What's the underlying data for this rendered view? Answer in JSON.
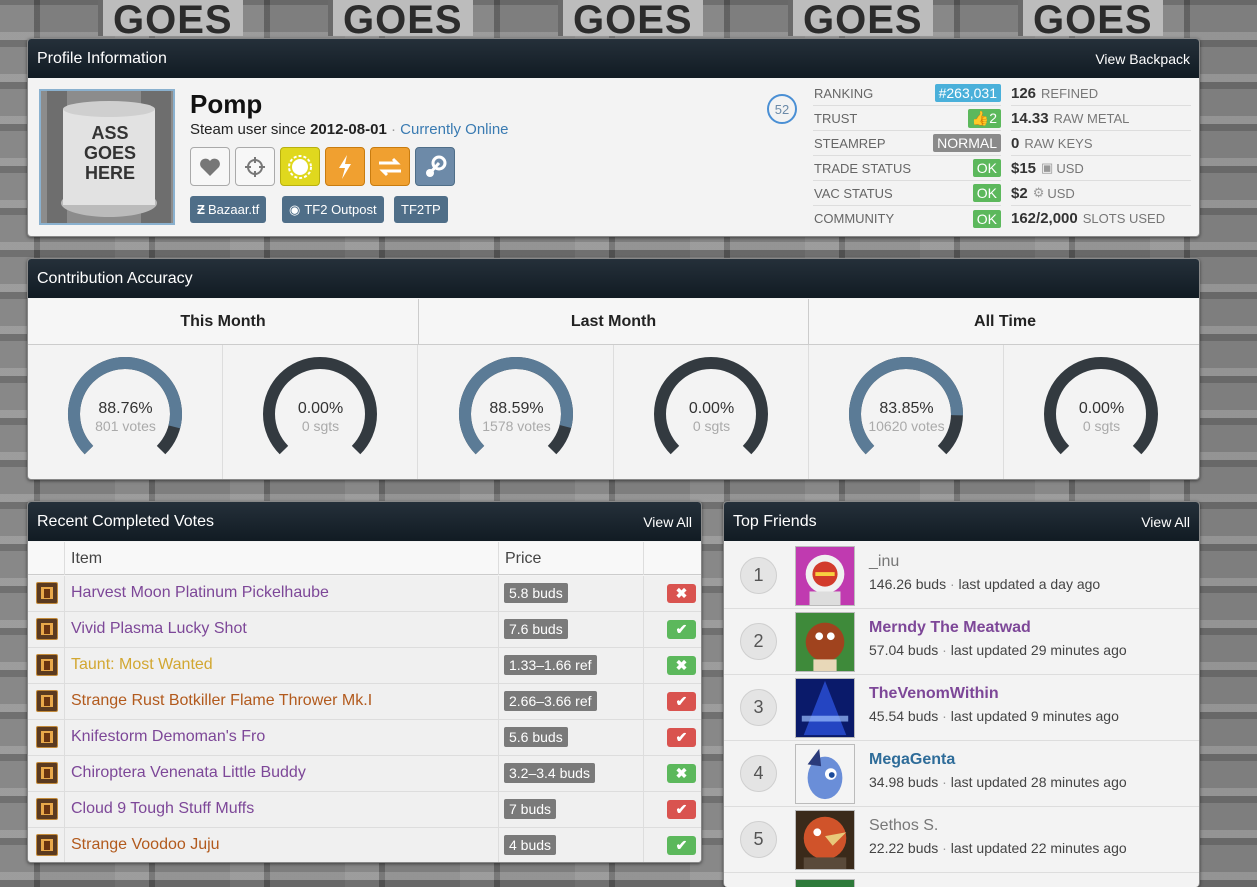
{
  "background": {
    "word": "GOES"
  },
  "profile": {
    "header": "Profile Information",
    "view_backpack": "View Backpack",
    "avatar_text": "ASS GOES HERE",
    "name": "Pomp",
    "since_prefix": "Steam user since ",
    "since_date": "2012-08-01",
    "separator": " · ",
    "status": "Currently Online",
    "level": "52",
    "icons": [
      {
        "name": "heart-icon",
        "color": "#f4f4f4"
      },
      {
        "name": "crosshair-icon",
        "color": "#f4f4f4"
      },
      {
        "name": "sun-icon",
        "color": "#e0d81e"
      },
      {
        "name": "lightning-icon",
        "color": "#f0a030"
      },
      {
        "name": "exchange-icon",
        "color": "#f0a030"
      },
      {
        "name": "steam-icon",
        "color": "#6d8aa8"
      }
    ],
    "links": [
      {
        "label": "Bazaar.tf",
        "icon": "bazaar-icon"
      },
      {
        "label": "TF2 Outpost",
        "icon": "outpost-icon"
      },
      {
        "label": "TF2TP",
        "icon": ""
      }
    ],
    "stats": [
      {
        "label": "RANKING",
        "value": "#263,031",
        "color": "#4ab0da"
      },
      {
        "label": "TRUST",
        "value": "2",
        "color": "#5cb85c",
        "icon": "thumbs-up-icon"
      },
      {
        "label": "STEAMREP",
        "value": "NORMAL",
        "color": "#8a8a8a"
      },
      {
        "label": "TRADE STATUS",
        "value": "OK",
        "color": "#5cb85c"
      },
      {
        "label": "VAC STATUS",
        "value": "OK",
        "color": "#5cb85c"
      },
      {
        "label": "COMMUNITY",
        "value": "OK",
        "color": "#5cb85c"
      }
    ],
    "resources": [
      {
        "value": "126",
        "label": "REFINED"
      },
      {
        "value": "14.33",
        "label": "RAW METAL"
      },
      {
        "value": "0",
        "label": "RAW KEYS"
      },
      {
        "value": "$15",
        "label": "USD",
        "icon": "backpack-icon"
      },
      {
        "value": "$2",
        "label": "USD",
        "icon": "steam-small-icon"
      },
      {
        "value": "162/2,000",
        "label": "SLOTS USED"
      }
    ]
  },
  "accuracy": {
    "header": "Contribution Accuracy",
    "periods": [
      {
        "label": "This Month",
        "votes_pct": "88.76%",
        "votes": "801 votes",
        "votes_frac": 0.8876,
        "sgts_pct": "0.00%",
        "sgts": "0 sgts",
        "sgts_frac": 0
      },
      {
        "label": "Last Month",
        "votes_pct": "88.59%",
        "votes": "1578 votes",
        "votes_frac": 0.8859,
        "sgts_pct": "0.00%",
        "sgts": "0 sgts",
        "sgts_frac": 0
      },
      {
        "label": "All Time",
        "votes_pct": "83.85%",
        "votes": "10620 votes",
        "votes_frac": 0.8385,
        "sgts_pct": "0.00%",
        "sgts": "0 sgts",
        "sgts_frac": 0
      }
    ],
    "colors": {
      "fill": "#5b7b96",
      "track": "#333a40"
    }
  },
  "votes": {
    "header": "Recent Completed Votes",
    "view_all": "View All",
    "columns": {
      "item": "Item",
      "price": "Price"
    },
    "rows": [
      {
        "name": "Harvest Moon Platinum Pickelhaube",
        "price": "5.8 buds",
        "color": "#7d4798",
        "status": "rejected",
        "mark": "✖"
      },
      {
        "name": "Vivid Plasma Lucky Shot",
        "price": "7.6 buds",
        "color": "#7d4798",
        "status": "accepted",
        "mark": "✔"
      },
      {
        "name": "Taunt: Most Wanted",
        "price": "1.33–1.66 ref",
        "color": "#d2a731",
        "status": "accepted-x",
        "mark": "✖"
      },
      {
        "name": "Strange Rust Botkiller Flame Thrower Mk.I",
        "price": "2.66–3.66 ref",
        "color": "#b25a1d",
        "status": "rejected",
        "mark": "✔"
      },
      {
        "name": "Knifestorm Demoman's Fro",
        "price": "5.6 buds",
        "color": "#7d4798",
        "status": "rejected",
        "mark": "✔"
      },
      {
        "name": "Chiroptera Venenata Little Buddy",
        "price": "3.2–3.4 buds",
        "color": "#7d4798",
        "status": "accepted-x",
        "mark": "✖"
      },
      {
        "name": "Cloud 9 Tough Stuff Muffs",
        "price": "7 buds",
        "color": "#7d4798",
        "status": "rejected",
        "mark": "✔"
      },
      {
        "name": "Strange Voodoo Juju",
        "price": "4 buds",
        "color": "#b25a1d",
        "status": "accepted",
        "mark": "✔"
      }
    ]
  },
  "friends": {
    "header": "Top Friends",
    "view_all": "View All",
    "rows": [
      {
        "rank": "1",
        "name": "_inu",
        "buds": "146.26 buds",
        "updated": "last updated a day ago",
        "color": "#777",
        "avatar": "astronaut-avatar"
      },
      {
        "rank": "2",
        "name": "Merndy The Meatwad",
        "buds": "57.04 buds",
        "updated": "last updated 29 minutes ago",
        "color": "#7d4798",
        "avatar": "meatwad-avatar"
      },
      {
        "rank": "3",
        "name": "TheVenomWithin",
        "buds": "45.54 buds",
        "updated": "last updated 9 minutes ago",
        "color": "#7d4798",
        "avatar": "blue-stage-avatar"
      },
      {
        "rank": "4",
        "name": "MegaGenta",
        "buds": "34.98 buds",
        "updated": "last updated 28 minutes ago",
        "color": "#2e6c99",
        "avatar": "pony-avatar"
      },
      {
        "rank": "5",
        "name": "Sethos S.",
        "buds": "22.22 buds",
        "updated": "last updated 22 minutes ago",
        "color": "#777",
        "avatar": "bird-avatar"
      }
    ]
  }
}
